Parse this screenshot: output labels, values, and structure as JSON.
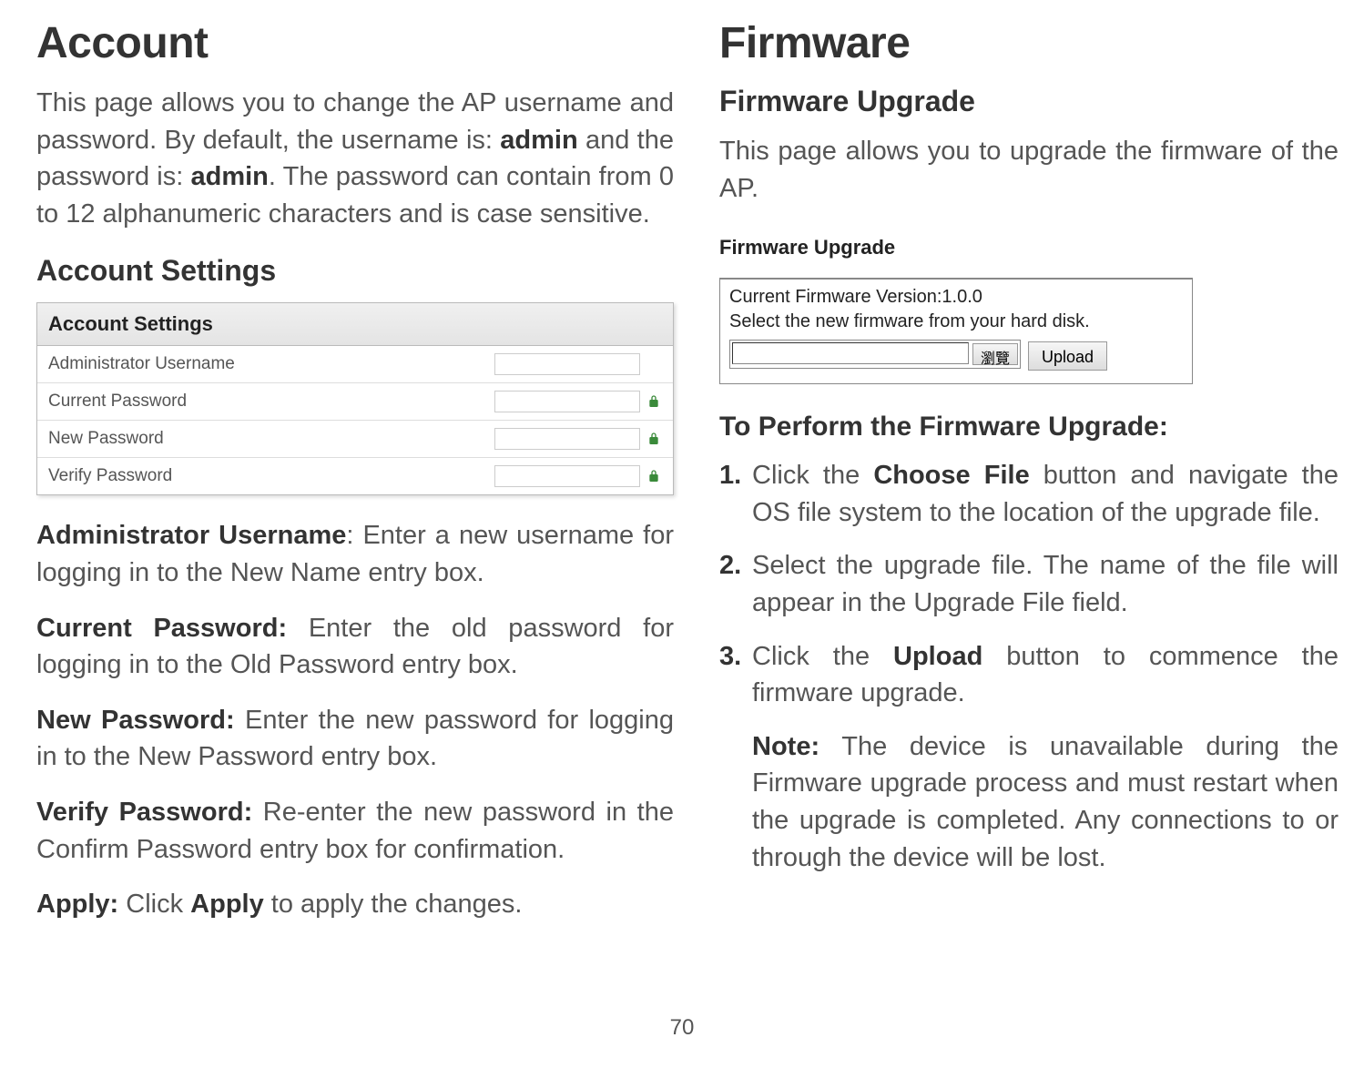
{
  "left": {
    "title": "Account",
    "intro_html": "This page allows you to change the AP username and password. By default, the username is: <b>admin</b> and the password is: <b>admin</b>. The password can contain from 0 to 12 alphanumeric characters and is case sensitive.",
    "subsection": "Account Settings",
    "table": {
      "header": "Account Settings",
      "rows": [
        {
          "label": "Administrator Username",
          "lock": false
        },
        {
          "label": "Current Password",
          "lock": true
        },
        {
          "label": "New Password",
          "lock": true
        },
        {
          "label": "Verify Password",
          "lock": true
        }
      ]
    },
    "defs": [
      {
        "term": "Administrator Username",
        "sep": ": ",
        "desc": "Enter a new username for logging in to the New Name entry box."
      },
      {
        "term": "Current Password:",
        "sep": " ",
        "desc": "Enter the old password for logging in to the Old Password entry box."
      },
      {
        "term": "New Password:",
        "sep": " ",
        "desc": "Enter the new password for logging in to the New Password entry box."
      },
      {
        "term": "Verify Password:",
        "sep": " ",
        "desc": "Re-enter the new password in the Confirm Password entry box for confirmation."
      },
      {
        "term": "Apply:",
        "sep": " ",
        "desc": "Click <b>Apply</b> to apply the changes."
      }
    ]
  },
  "right": {
    "title": "Firmware",
    "subsection": "Firmware Upgrade",
    "intro": "This page allows you to upgrade the firmware of the AP.",
    "box": {
      "title": "Firmware Upgrade",
      "current_version_label": "Current Firmware Version:1.0.0",
      "select_text": "Select the new firmware from your hard disk.",
      "browse_label": "瀏覽",
      "upload_label": "Upload"
    },
    "perform_title": "To Perform the Firmware Upgrade:",
    "steps": [
      {
        "num": "1.",
        "html": "Click the <b>Choose File</b> button and navigate the OS file system to the location of the upgrade file."
      },
      {
        "num": "2.",
        "html": "Select the upgrade file. The name of the file will appear in the Upgrade File field."
      },
      {
        "num": "3.",
        "html": "Click the <b>Upload</b> button to commence the firmware upgrade."
      }
    ],
    "note_html": "<b>Note:</b> The device is unavailable during the Firmware upgrade process and must restart when the upgrade is completed. Any connections to or through the device will be lost."
  },
  "page_number": "70"
}
